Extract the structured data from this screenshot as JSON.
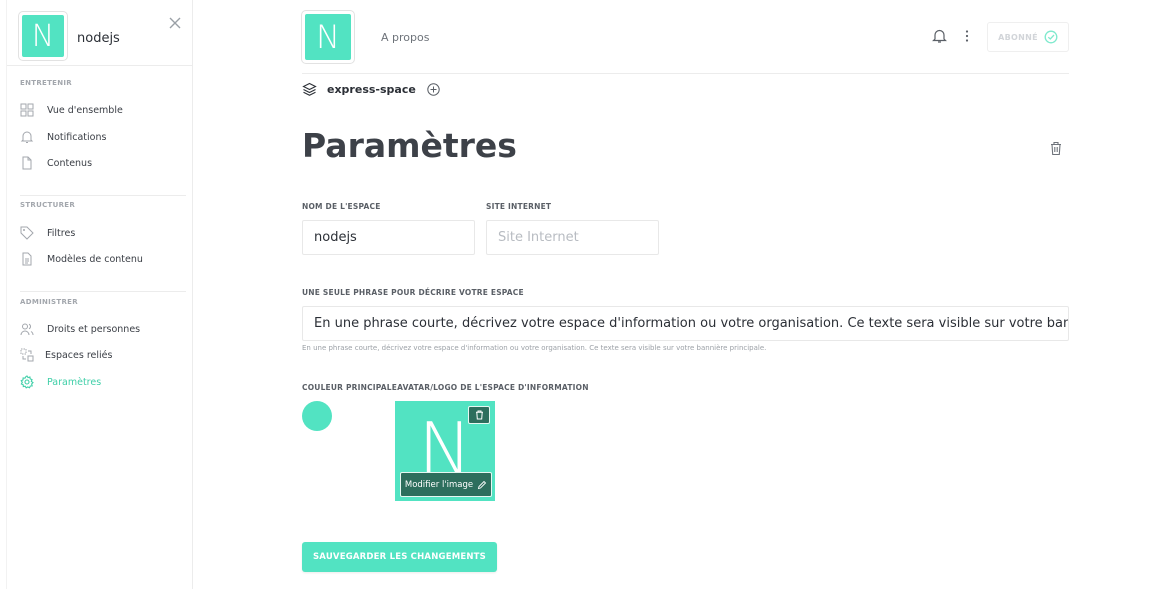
{
  "sidebar": {
    "logo_letter": "N",
    "title": "nodejs",
    "sections": [
      {
        "title": "ENTRETENIR",
        "items": [
          {
            "label": "Vue d'ensemble",
            "icon": "grid-icon"
          },
          {
            "label": "Notifications",
            "icon": "bell-icon"
          },
          {
            "label": "Contenus",
            "icon": "file-icon"
          }
        ]
      },
      {
        "title": "STRUCTURER",
        "items": [
          {
            "label": "Filtres",
            "icon": "tag-icon"
          },
          {
            "label": "Modèles de contenu",
            "icon": "template-icon"
          }
        ]
      },
      {
        "title": "ADMINISTRER",
        "items": [
          {
            "label": "Droits et personnes",
            "icon": "users-icon"
          },
          {
            "label": "Espaces reliés",
            "icon": "linked-spaces-icon"
          },
          {
            "label": "Paramètres",
            "icon": "gear-icon",
            "active": true
          }
        ]
      }
    ]
  },
  "header": {
    "logo_letter": "N",
    "about_label": "A propos",
    "subscribe_label": "ABONNÉ"
  },
  "space": {
    "name": "express-space"
  },
  "page": {
    "title": "Paramètres"
  },
  "form": {
    "space_name_label": "NOM DE L'ESPACE",
    "space_name_value": "nodejs",
    "website_label": "SITE INTERNET",
    "website_placeholder": "Site Internet",
    "description_label": "UNE SEULE PHRASE POUR DÉCRIRE VOTRE ESPACE",
    "description_value": "En une phrase courte, décrivez votre espace d'information ou votre organisation. Ce texte sera visible sur votre bannière principale.",
    "description_helper": "En une phrase courte, décrivez votre espace d'information ou votre organisation. Ce texte sera visible sur votre bannière principale.",
    "color_avatar_label": "COULEUR PRINCIPALEAVATAR/LOGO DE L'ESPACE D'INFORMATION",
    "avatar_letter": "N",
    "modify_image_label": "Modifier l'image",
    "save_label": "SAUVEGARDER LES CHANGEMENTS"
  },
  "colors": {
    "accent": "#52e3c2",
    "accent_dark": "#2d6e5d",
    "active_nav": "#3fcfa8"
  }
}
